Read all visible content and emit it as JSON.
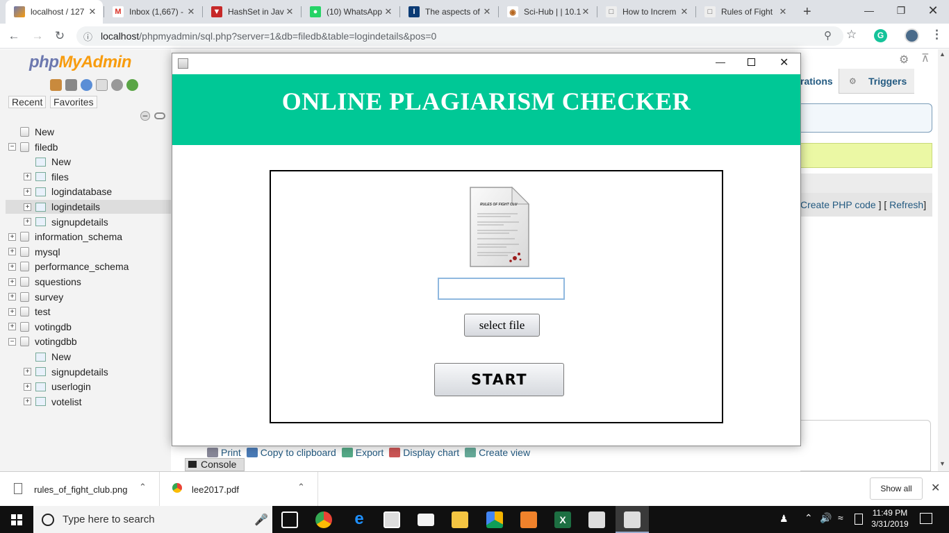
{
  "browser": {
    "tabs": [
      {
        "title": "localhost / 127",
        "favicon": "phpmyadmin-icon",
        "active": true
      },
      {
        "title": "Inbox (1,667) -",
        "favicon": "gmail-icon"
      },
      {
        "title": "HashSet in Jav",
        "favicon": "geeks-icon"
      },
      {
        "title": "(10) WhatsApp",
        "favicon": "whatsapp-icon"
      },
      {
        "title": "The aspects of",
        "favicon": "ieee-icon"
      },
      {
        "title": "Sci-Hub | | 10.1",
        "favicon": "scihub-icon"
      },
      {
        "title": "How to Increm",
        "favicon": "page-icon"
      },
      {
        "title": "Rules of Fight",
        "favicon": "page-icon"
      }
    ],
    "new_tab": "+",
    "url_host": "localhost",
    "url_rest": "/phpmyadmin/sql.php?server=1&db=filedb&table=logindetails&pos=0",
    "profile_initial": "G"
  },
  "pma": {
    "logo_php": "php",
    "logo_myadmin": "MyAdmin",
    "recent_label": "Recent",
    "favorites_label": "Favorites",
    "tree": [
      {
        "label": "New",
        "type": "new",
        "level": 0
      },
      {
        "label": "filedb",
        "type": "db",
        "level": 0,
        "expanded": true
      },
      {
        "label": "New",
        "type": "new",
        "level": 1
      },
      {
        "label": "files",
        "type": "table",
        "level": 1
      },
      {
        "label": "logindatabase",
        "type": "table",
        "level": 1
      },
      {
        "label": "logindetails",
        "type": "table",
        "level": 1,
        "selected": true
      },
      {
        "label": "signupdetails",
        "type": "table",
        "level": 1
      },
      {
        "label": "information_schema",
        "type": "db",
        "level": 0
      },
      {
        "label": "mysql",
        "type": "db",
        "level": 0
      },
      {
        "label": "performance_schema",
        "type": "db",
        "level": 0
      },
      {
        "label": "squestions",
        "type": "db",
        "level": 0
      },
      {
        "label": "survey",
        "type": "db",
        "level": 0
      },
      {
        "label": "test",
        "type": "db",
        "level": 0
      },
      {
        "label": "votingdb",
        "type": "db",
        "level": 0
      },
      {
        "label": "votingdbb",
        "type": "db",
        "level": 0,
        "expanded": true
      },
      {
        "label": "New",
        "type": "new",
        "level": 1
      },
      {
        "label": "signupdetails",
        "type": "table",
        "level": 1
      },
      {
        "label": "userlogin",
        "type": "table",
        "level": 1
      },
      {
        "label": "votelist",
        "type": "table",
        "level": 1
      }
    ],
    "tab_operations_partial": "rations",
    "tab_triggers": "Triggers",
    "create_php_code": "Create PHP code",
    "refresh": "Refresh",
    "bracket_mid": "] [",
    "bracket_end": "]",
    "actions": [
      {
        "label": "Print",
        "icon": "print-icon"
      },
      {
        "label": "Copy to clipboard",
        "icon": "clipboard-icon"
      },
      {
        "label": "Export",
        "icon": "export-icon"
      },
      {
        "label": "Display chart",
        "icon": "chart-icon"
      },
      {
        "label": "Create view",
        "icon": "view-icon"
      }
    ],
    "console_label": "Console"
  },
  "dialog": {
    "title": "ONLINE PLAGIARISM CHECKER",
    "file_input_value": "",
    "select_file_label": "select file",
    "start_label": "START",
    "document_heading": "RULES OF FIGHT CLU",
    "header_color": "#00c896"
  },
  "downloads": {
    "items": [
      {
        "name": "rules_of_fight_club.png",
        "icon": "image-file-icon"
      },
      {
        "name": "lee2017.pdf",
        "icon": "chrome-file-icon"
      }
    ],
    "show_all": "Show all"
  },
  "taskbar": {
    "search_placeholder": "Type here to search",
    "time": "11:49 PM",
    "date": "3/31/2019"
  }
}
